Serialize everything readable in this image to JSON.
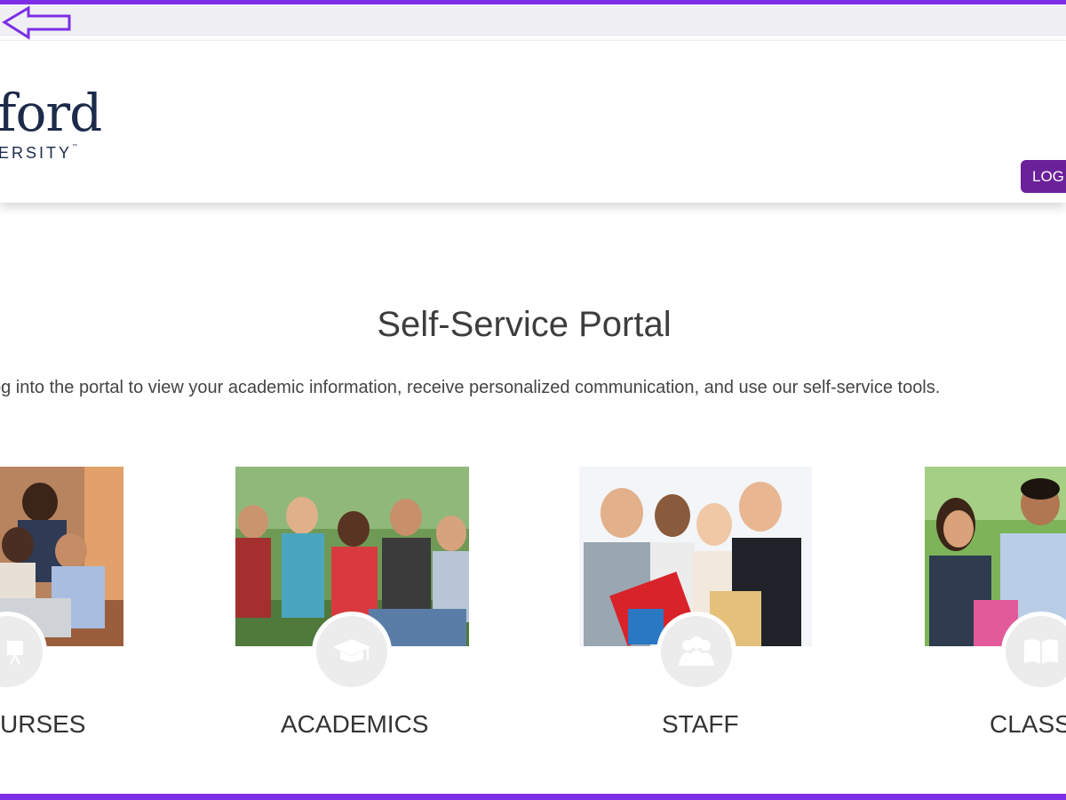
{
  "header": {
    "logo_word": "ford",
    "logo_sub": "ERSITY",
    "logo_tm": "™",
    "login_label": "LOG"
  },
  "main": {
    "title": "Self-Service Portal",
    "subtitle": "og into the portal to view your academic information, receive personalized communication, and use our self-service tools."
  },
  "cards": [
    {
      "label": "URSES",
      "icon": "presentation-icon"
    },
    {
      "label": "ACADEMICS",
      "icon": "graduation-cap-icon"
    },
    {
      "label": "STAFF",
      "icon": "people-icon"
    },
    {
      "label": "CLASS",
      "icon": "book-icon"
    }
  ],
  "colors": {
    "accent": "#7d2ee6",
    "button": "#6b2199",
    "logo": "#1c2b4a"
  }
}
